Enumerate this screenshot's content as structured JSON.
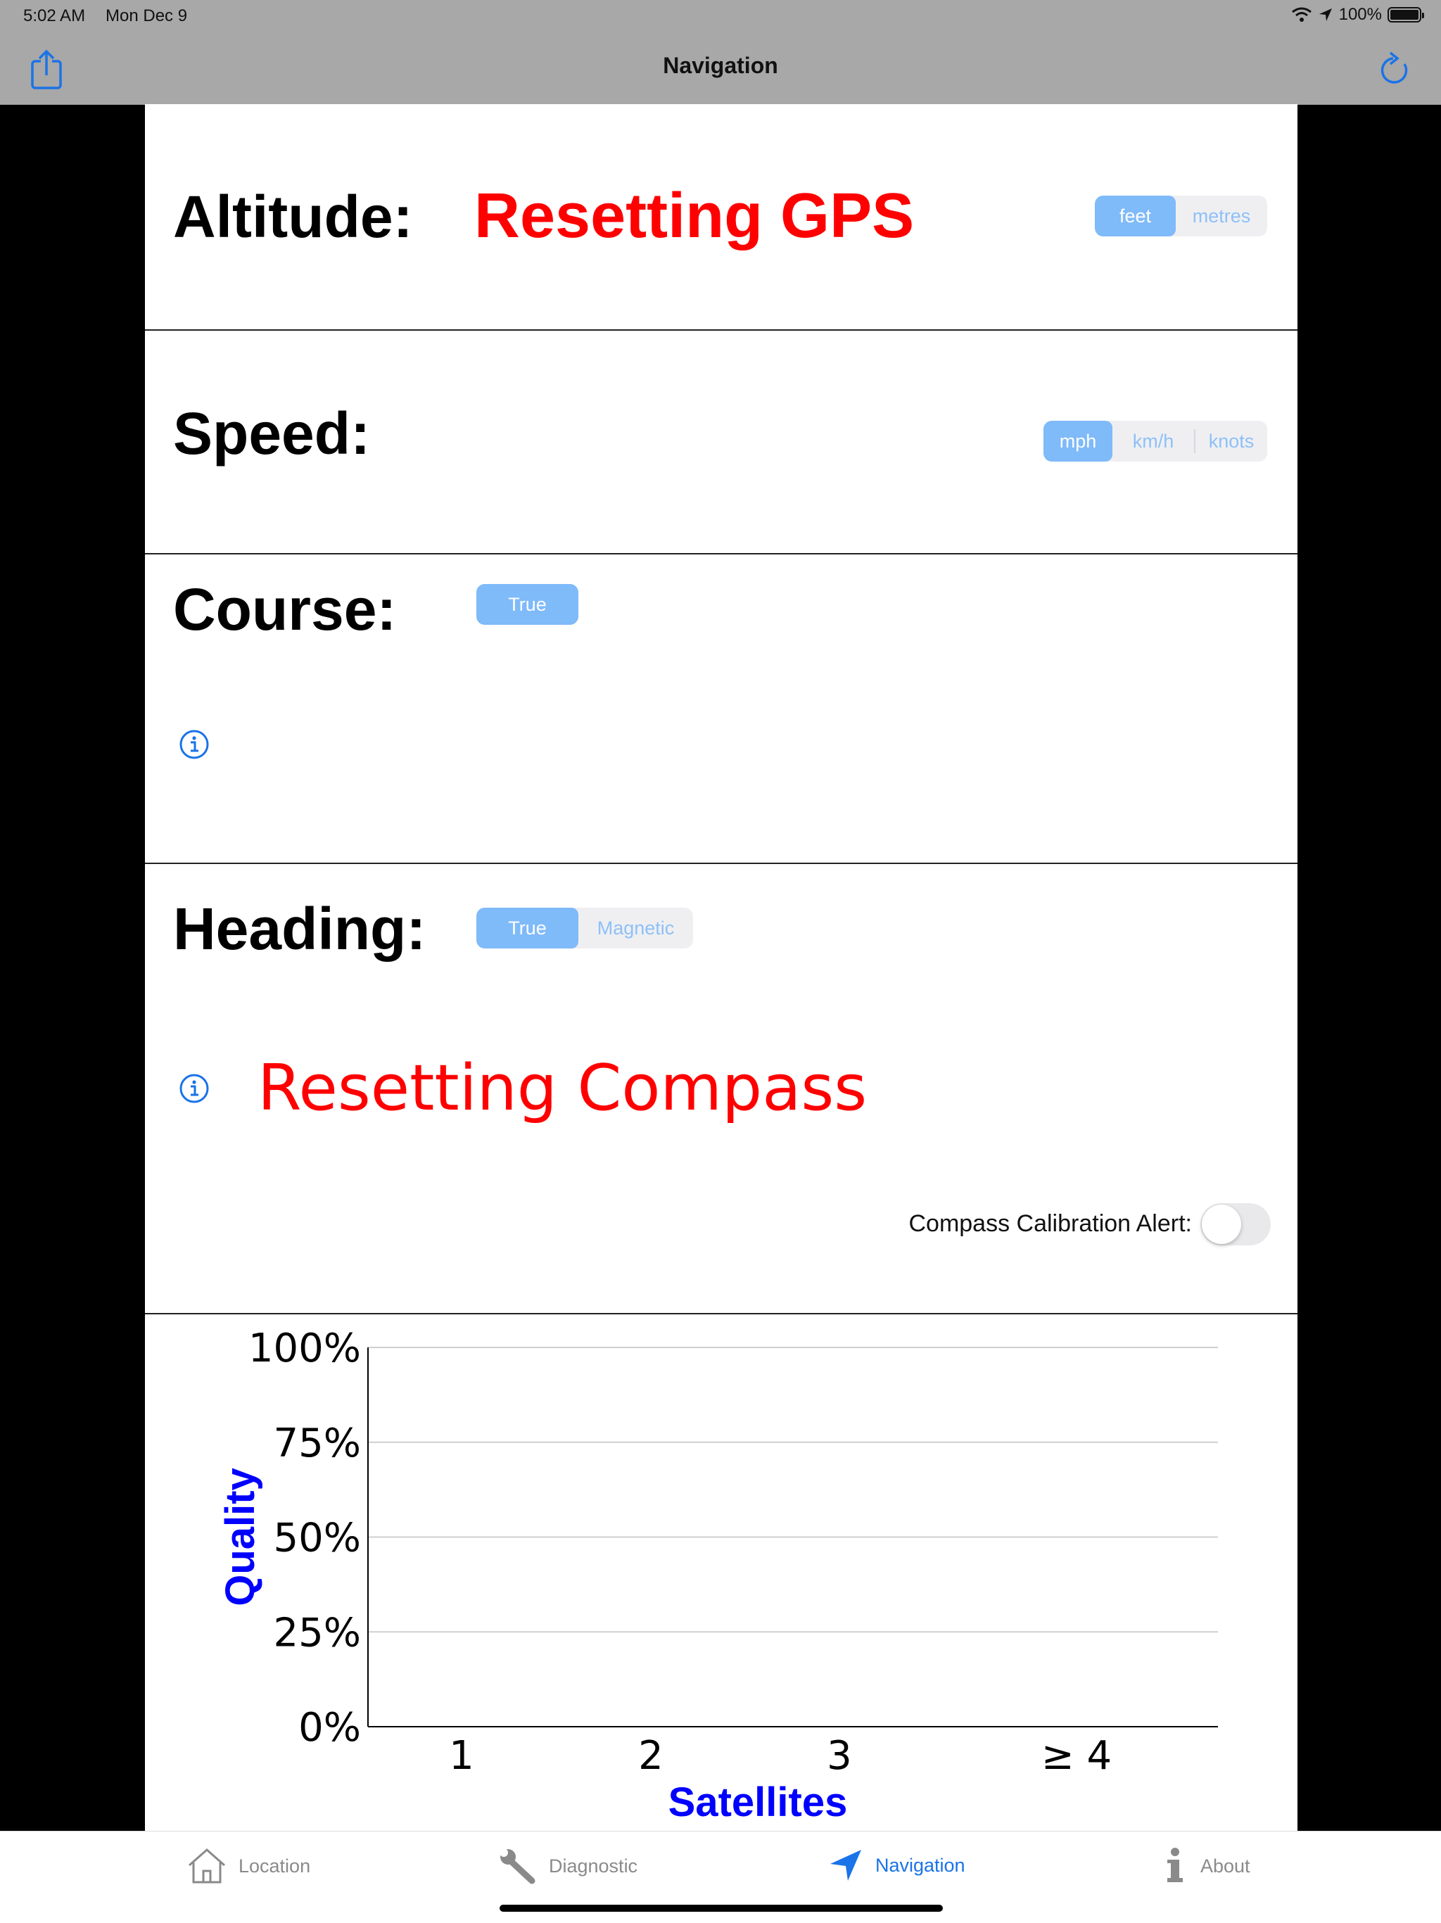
{
  "status_bar": {
    "time": "5:02 AM",
    "date": "Mon Dec 9",
    "battery": "100%"
  },
  "nav": {
    "title": "Navigation"
  },
  "altitude": {
    "label": "Altitude:",
    "value": "Resetting GPS",
    "units": [
      "feet",
      "metres"
    ],
    "selected_unit": "feet"
  },
  "speed": {
    "label": "Speed:",
    "units": [
      "mph",
      "km/h",
      "knots"
    ],
    "selected_unit": "mph"
  },
  "course": {
    "label": "Course:",
    "reference": [
      "True"
    ],
    "selected_reference": "True"
  },
  "heading": {
    "label": "Heading:",
    "reference": [
      "True",
      "Magnetic"
    ],
    "selected_reference": "True",
    "value": "Resetting Compass",
    "calibration_alert_label": "Compass Calibration Alert:",
    "calibration_alert_on": false
  },
  "chart_data": {
    "type": "bar",
    "categories": [
      "1",
      "2",
      "3",
      "≥ 4"
    ],
    "values": [
      0,
      0,
      0,
      0
    ],
    "xlabel": "Satellites",
    "ylabel": "Quality",
    "yticks": [
      "0%",
      "25%",
      "50%",
      "75%",
      "100%"
    ],
    "ylim": [
      0,
      100
    ],
    "grid": true,
    "label_color": "#0000ff"
  },
  "tabs": [
    {
      "label": "Location",
      "icon": "house-icon",
      "active": false
    },
    {
      "label": "Diagnostic",
      "icon": "wrench-icon",
      "active": false
    },
    {
      "label": "Navigation",
      "icon": "location-arrow-icon",
      "active": true
    },
    {
      "label": "About",
      "icon": "info-i-icon",
      "active": false
    }
  ],
  "colors": {
    "accent": "#1a73e8",
    "alert": "#ff0000",
    "segment_selected": "#7fbaf9"
  }
}
